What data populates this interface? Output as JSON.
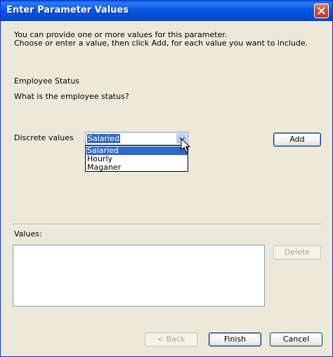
{
  "window": {
    "title": "Enter Parameter Values"
  },
  "intro": {
    "line1": "You can provide one or more values for this parameter.",
    "line2": "Choose or enter a value, then click Add, for each value you want to include."
  },
  "parameter": {
    "name": "Employee Status",
    "prompt": "What is the employee status?"
  },
  "discrete": {
    "label": "Discrete values",
    "selected_value": "Salaried",
    "options": [
      "Salaried",
      "Hourly",
      "Maganer"
    ],
    "add_label": "Add"
  },
  "values": {
    "label": "Values:",
    "delete_label": "Delete"
  },
  "footer": {
    "back_label": "< Back",
    "finish_label": "Finish",
    "cancel_label": "Cancel"
  },
  "colors": {
    "titlebar": "#0058E6",
    "dialog_bg": "#ECE9D8",
    "selection": "#316AC5"
  }
}
